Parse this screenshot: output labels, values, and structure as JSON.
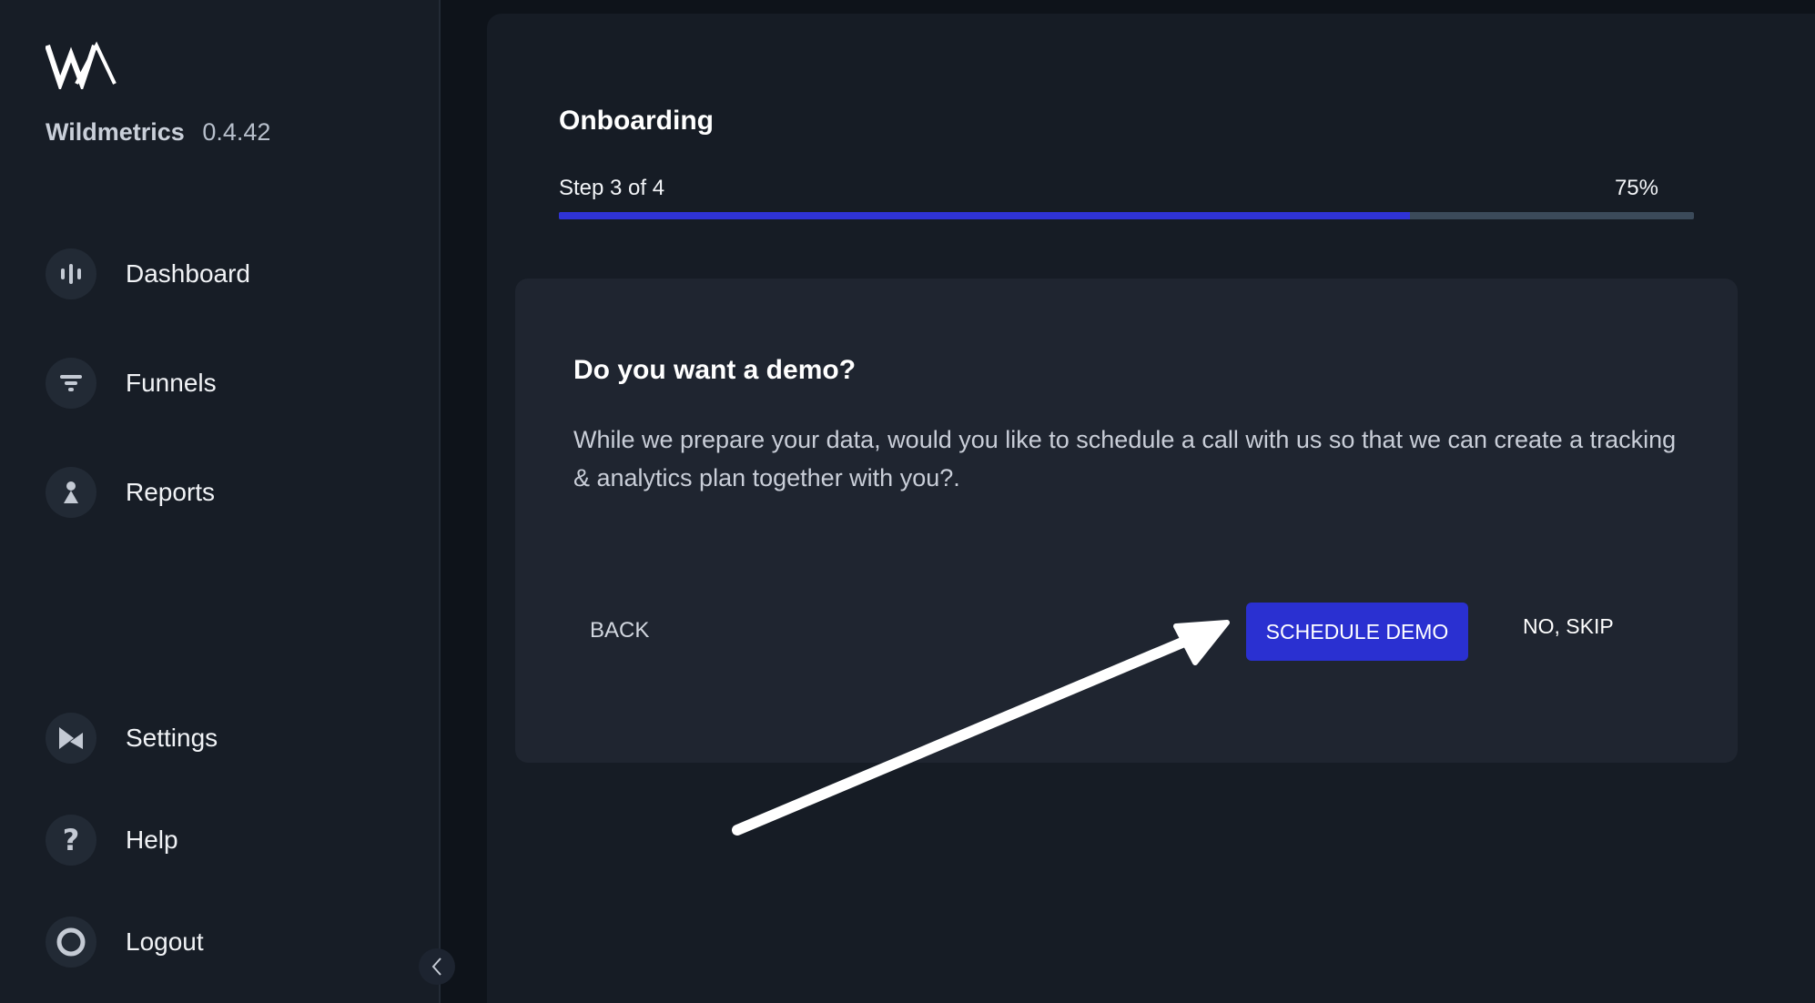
{
  "sidebar": {
    "brand_name": "Wildmetrics",
    "version": "0.4.42",
    "nav": [
      {
        "label": "Dashboard",
        "icon": "bar-chart-icon"
      },
      {
        "label": "Funnels",
        "icon": "funnel-icon"
      },
      {
        "label": "Reports",
        "icon": "person-icon"
      }
    ],
    "bottom_nav": [
      {
        "label": "Settings",
        "icon": "settings-flag-icon"
      },
      {
        "label": "Help",
        "icon": "question-icon"
      },
      {
        "label": "Logout",
        "icon": "circle-icon"
      }
    ]
  },
  "onboarding": {
    "title": "Onboarding",
    "step_text": "Step 3 of 4",
    "percent_text": "75%",
    "progress": 0.75
  },
  "card": {
    "title": "Do you want a demo?",
    "body": "While we prepare your data, would you like to schedule a call with us so that we can create a tracking & analytics plan together with you?.",
    "back_label": "BACK",
    "schedule_label": "SCHEDULE DEMO",
    "skip_label": "NO, SKIP"
  },
  "colors": {
    "accent": "#2a30d1",
    "progress_track": "#3b4a5a",
    "sidebar_bg": "#171d26",
    "main_bg": "#161c25",
    "card_bg": "#1f2530"
  }
}
